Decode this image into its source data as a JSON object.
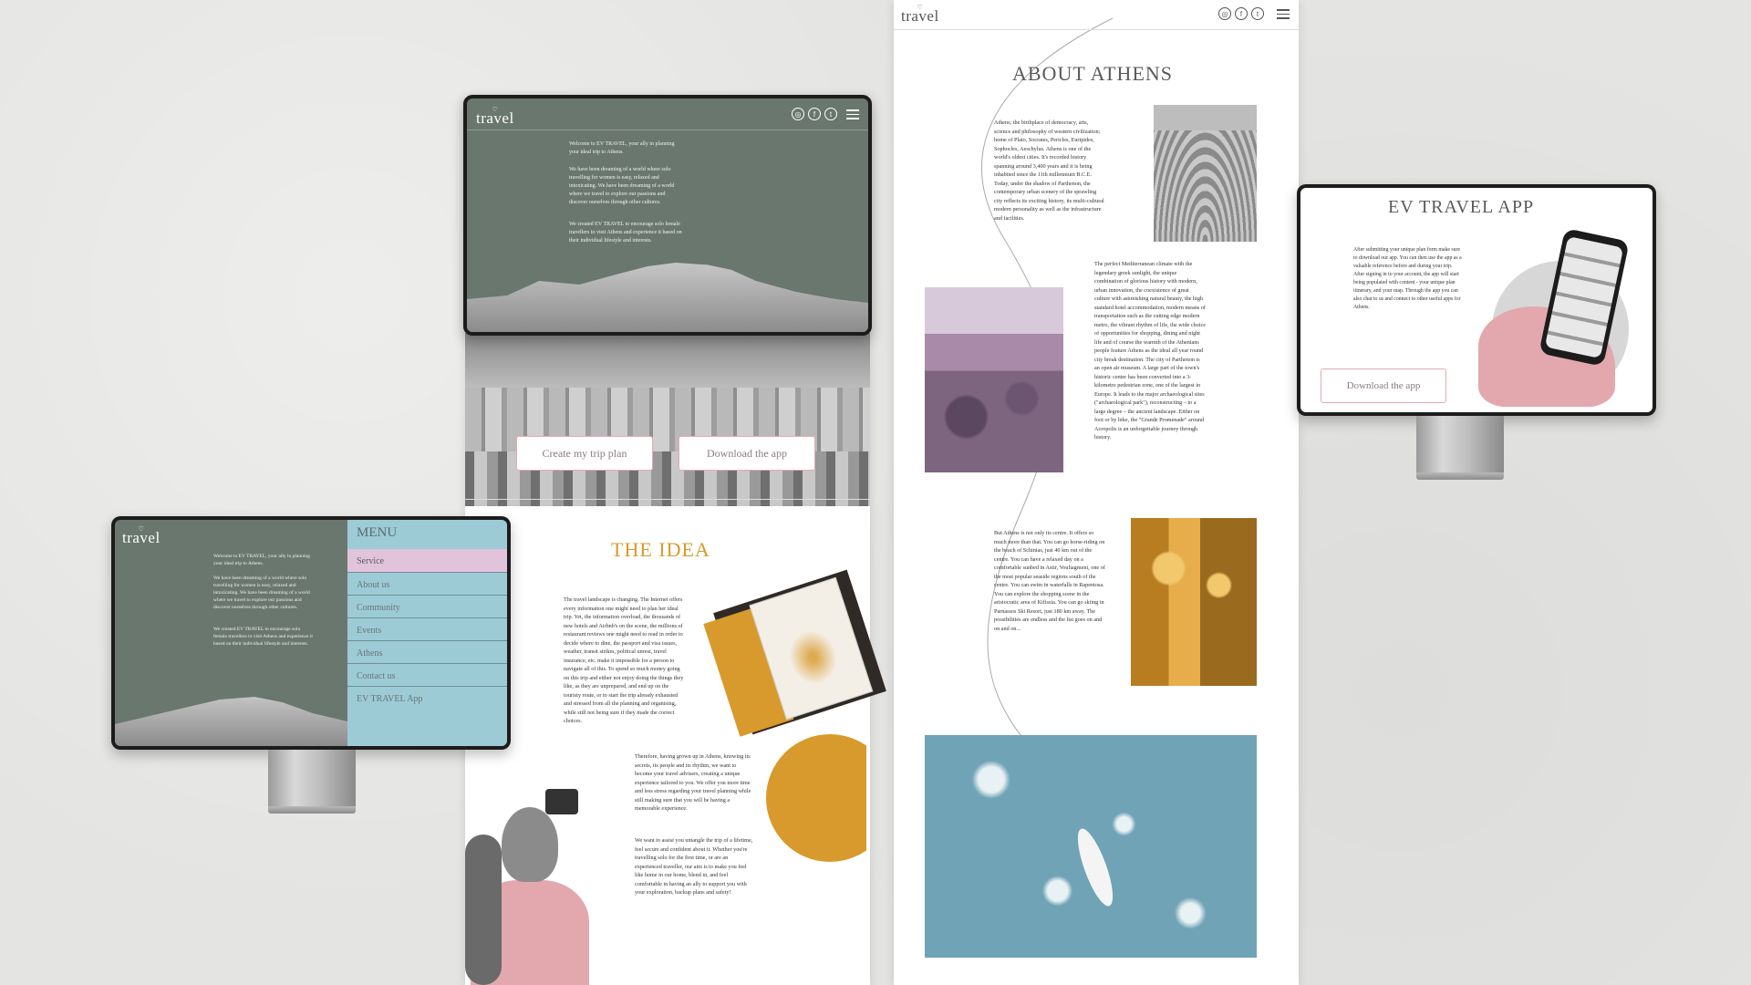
{
  "brand": {
    "logo": "travel",
    "accent_pink": "#e7a9b2",
    "sage": "#69776f",
    "teal_menu": "#9ccbd6",
    "mustard": "#d89a2c",
    "mauve": "#a98aa9"
  },
  "social_icons": [
    "instagram-icon",
    "facebook-icon",
    "twitter-icon"
  ],
  "intro": {
    "p1": "Welcome to EV TRAVEL, your ally in planning your ideal trip to Athens.",
    "p2": "We have been dreaming of a world where solo travelling for women is easy, relaxed and intoxicating. We have been dreaming of a world where we travel to explore our passions and discover ourselves through other cultures.",
    "p3": "We created EV TRAVEL to encourage solo female travellers to visit Athens and experience it based on their individual lifestyle and interests."
  },
  "menu": {
    "title": "MENU",
    "items": [
      "Service",
      "About us",
      "Community",
      "Events",
      "Athens",
      "Contact us",
      "EV TRAVEL App"
    ],
    "active_index": 0
  },
  "buttons": {
    "create_trip": "Create my trip plan",
    "download_app": "Download the app"
  },
  "idea": {
    "title": "THE IDEA",
    "p1": "The travel landscape is changing. The Internet offers every information one might need to plan her ideal trip. Yet, the information overload, the thousands of new hotels and Airbnb's on the scene, the millions of restaurant reviews one might need to read in order to decide where to dine, the passport and visa issues, weather, transit strikes, political unrest, travel insurance, etc. make it impossible for a person to navigate all of this. To spend so much money going on this trip and either not enjoy doing the things they like, as they are unprepared, and end up on the touristy route, or to start the trip already exhausted and stressed from all the planning and organising, while still not being sure if they made the correct choices.",
    "p2": "Therefore, having grown up in Athens, knowing its secrets, its people and its rhythm, we want to become your travel advisers, creating a unique experience tailored to you. We offer you more time and less stress regarding your travel planning while still making sure that you will be having a memorable experience.",
    "p3": "We want to assist you untangle the trip of a lifetime, feel secure and confident about it. Whether you're travelling solo for the first time, or are an experienced traveller, our aim is to make you feel like home in our home, blend in, and feel comfortable in having an ally to support you with your exploration, backup plans and safety!"
  },
  "athens": {
    "title": "ABOUT ATHENS",
    "p1": "Athens; the birthplace of democracy, arts, science and philosophy of western civilization; home of Plato, Socrates, Pericles, Euripides, Sophocles, Aeschylus. Athens is one of the world's oldest cities. It's recorded history spanning around 3,400 years and it is being inhabited since the 11th millennium B.C.E. Today, under the shadow of Parthenon, the contemporary urban scenery of the sprawling city reflects its exciting history, its multi-cultural modern personality as well as the infrastructure and facilities.",
    "p2": "The perfect Mediterranean climate with the legendary greek sunlight, the unique combination of glorious history with modern, urban innovation, the coexistence of great culture with astonishing natural beauty, the high standard hotel accommodation, modern means of transportation such as the cutting edge modern metro, the vibrant rhythm of life, the wide choice of opportunities for shopping, dining and night life and of course the warmth of the Athenians people feature Athens as the ideal all year round city break destination. The city of Parthenon is an open air museum. A large part of the town's historic center has been converted into a 3-kilometre pedestrian zone, one of the largest in Europe. It leads to the major archaeological sites (\"archaeological park\"), reconstructing – to a large degree – the ancient landscape. Either on foot or by bike, the \"Grande Promenade\" around Acropolis is an unforgettable journey through history.",
    "p3": "But Athens is not only its centre. It offers so much more than that. You can go horse-riding on the beach of Schinias, just 40 km out of the centre. You can have a relaxed day on a comfortable sunbed in Astir, Vouliagmeni, one of the most popular seaside regions south of the centre. You can swim in waterfalls in Rapentosa. You can explore the shopping scene in the aristocratic area of Kifissia. You can go skiing in Parnassos Ski Resort, just 180 km away. The possibilities are endless and the list goes on and on and on..."
  },
  "app": {
    "title": "EV TRAVEL APP",
    "text": "After submitting your unique plan form make sure to download our app. You can then use the app as a valuable reference before and during your trip. After signing in to your account, the app will start being populated with content - your unique plan itinerary, and your map. Through the app you can also chat to us and connect to other useful apps for Athens.",
    "button": "Download the app"
  }
}
